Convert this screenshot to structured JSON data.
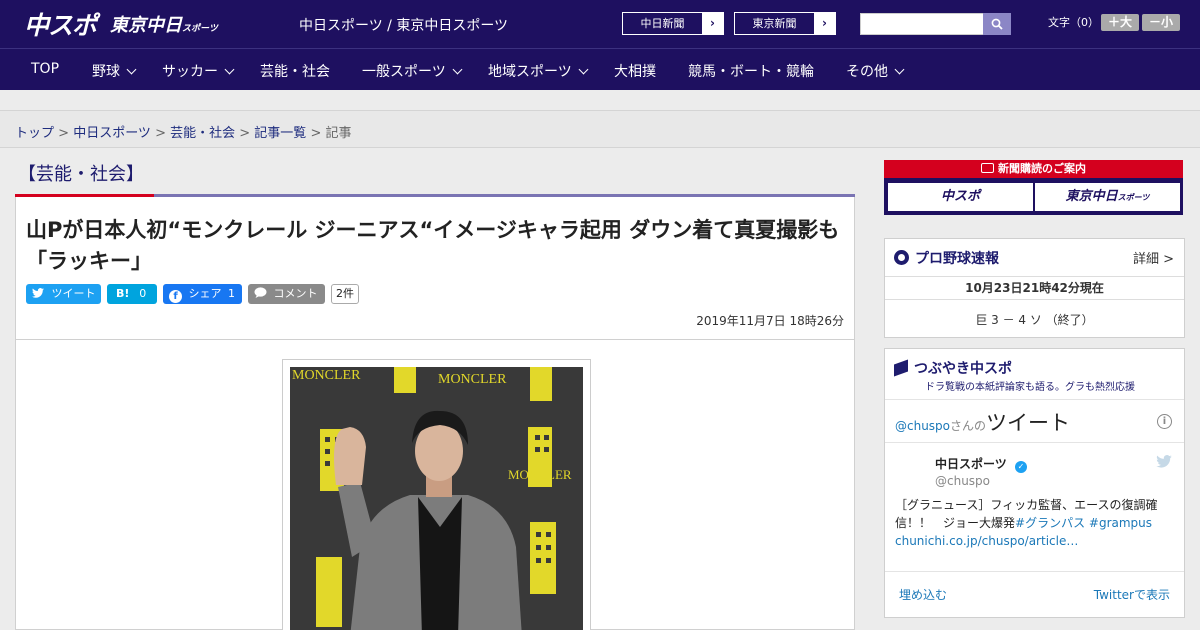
{
  "header": {
    "logo_main": "中スポ",
    "logo_sub": "東京中日",
    "logo_sub_small": "スポーツ",
    "site_links": "中日スポーツ / 東京中日スポーツ",
    "paper_buttons": [
      "中日新聞",
      "東京新聞"
    ],
    "text_size_label": "文字（0）",
    "size_up": "＋大",
    "size_down": "－小"
  },
  "nav": {
    "items": [
      "TOP",
      "野球",
      "サッカー",
      "芸能・社会",
      "一般スポーツ",
      "地域スポーツ",
      "大相撲",
      "競馬・ボート・競輪",
      "その他"
    ]
  },
  "breadcrumb": {
    "items": [
      "トップ",
      "中日スポーツ",
      "芸能・社会",
      "記事一覧"
    ],
    "current": "記事",
    "separator": " > "
  },
  "article": {
    "category": "【芸能・社会】",
    "headline": "山Pが日本人初“モンクレール ジーニアス“イメージキャラ起用 ダウン着て真夏撮影も「ラッキー」",
    "share": {
      "tweet_label": "ツイート",
      "hatena_label": "B!",
      "hatena_count": "0",
      "fb_label": "シェア",
      "fb_count": "1",
      "comment_label": "コメント",
      "comment_count": "2件"
    },
    "date": "2019年11月7日 18時26分",
    "photo_text": [
      "MONCLER",
      "MONCLER",
      "MONCLER"
    ]
  },
  "sidebar": {
    "ad": {
      "title": "新聞購読のご案内",
      "button1": "中スポ",
      "button2": "東京中日",
      "button2_small": "スポーツ"
    },
    "baseball": {
      "title": "プロ野球速報",
      "more": "詳細 >",
      "time": "10月23日21時42分現在",
      "score": "巨 3 － 4 ソ （終了）"
    },
    "tweets": {
      "title": "つぶやき中スポ",
      "subtitle": "ドラ覧戦の本紙評論家も語る。グラも熱烈応援",
      "handle_label": "@chuspo",
      "handle_suffix": "さんの",
      "header_word": "ツイート",
      "account_name": "中日スポーツ",
      "account_handle": "@chuspo",
      "tweet_text": "［グラニュース］フィッカ監督、エースの復調確信！！　ジョー大爆発",
      "hashtag1": "#グランパス",
      "hashtag2": "#grampus",
      "link": "chunichi.co.jp/chuspo/article…",
      "embed": "埋め込む",
      "view_on": "Twitterで表示"
    }
  },
  "colors": {
    "brand": "#1e1060",
    "accent_red": "#d4001e",
    "twitter": "#1da1f2",
    "hatena": "#00a4de",
    "facebook": "#1877f2"
  }
}
